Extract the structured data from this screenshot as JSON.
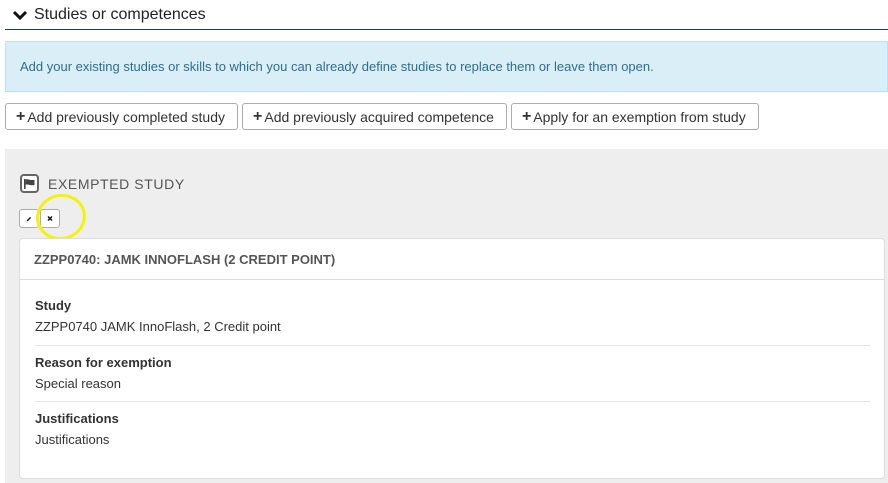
{
  "section": {
    "title": "Studies or competences"
  },
  "info": {
    "text": "Add your existing studies or skills to which you can already define studies to replace them or leave them open."
  },
  "buttons": [
    {
      "label": "Add previously completed study"
    },
    {
      "label": "Add previously acquired competence"
    },
    {
      "label": "Apply for an exemption from study"
    }
  ],
  "exempted": {
    "heading": "EXEMPTED STUDY",
    "card_title": "ZZPP0740: JAMK INNOFLASH (2 CREDIT POINT)",
    "fields": [
      {
        "label": "Study",
        "value": "ZZPP0740 JAMK InnoFlash, 2 Credit point"
      },
      {
        "label": "Reason for exemption",
        "value": "Special reason"
      },
      {
        "label": "Justifications",
        "value": "Justifications"
      }
    ]
  },
  "colors": {
    "highlight": "#f5f20a",
    "info_bg": "#d9eef7",
    "panel_bg": "#eeeeee"
  }
}
